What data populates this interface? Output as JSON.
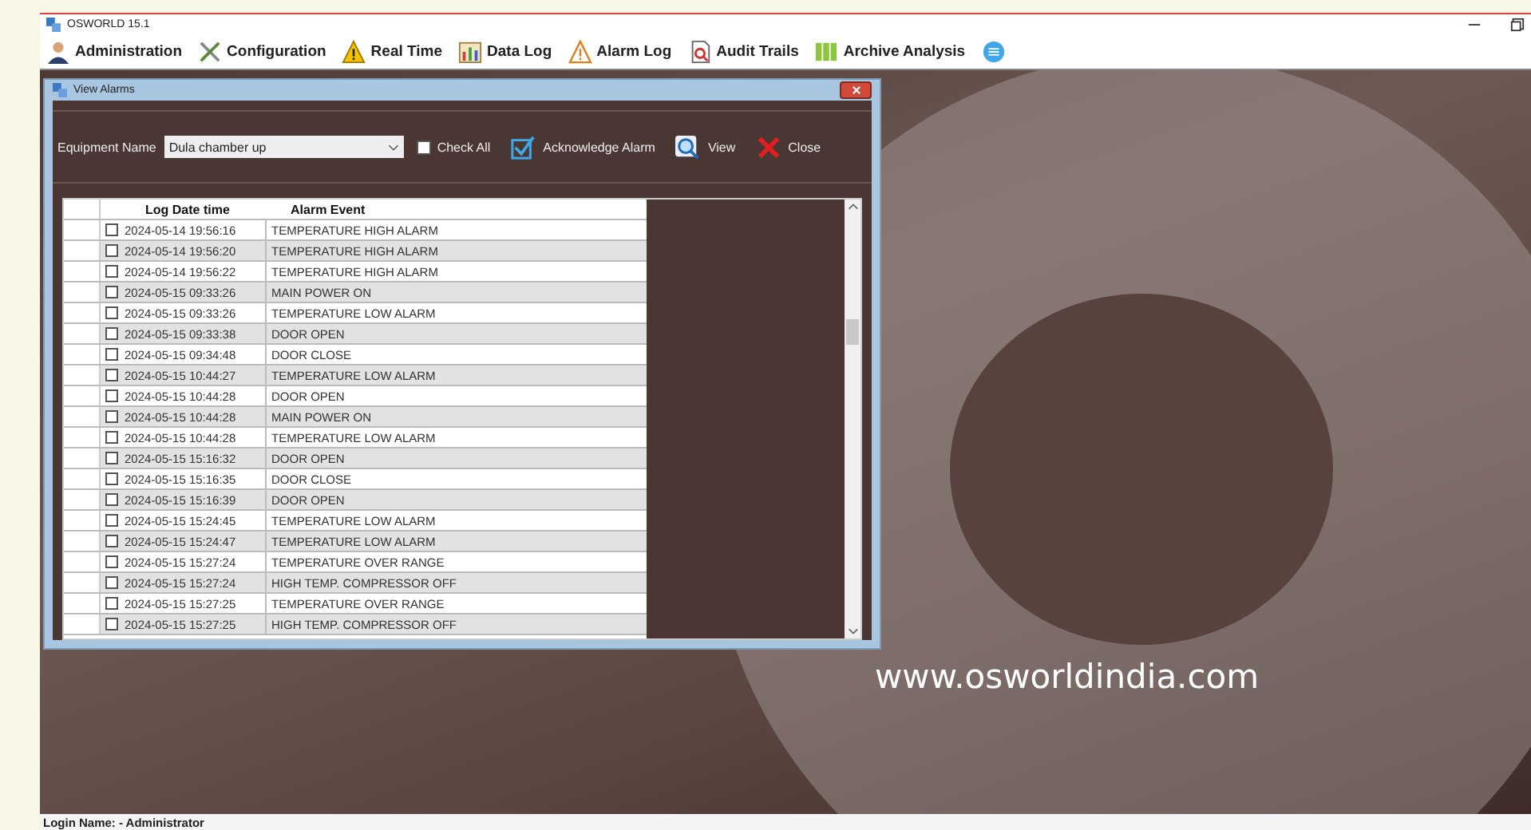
{
  "window": {
    "title": "OSWORLD 15.1"
  },
  "toolbar": [
    {
      "label": "Administration",
      "kind": "person"
    },
    {
      "label": "Configuration",
      "kind": "tools"
    },
    {
      "label": "Real Time",
      "kind": "warning"
    },
    {
      "label": "Data Log",
      "kind": "chart"
    },
    {
      "label": "Alarm Log",
      "kind": "alarm"
    },
    {
      "label": "Audit Trails",
      "kind": "audit"
    },
    {
      "label": "Archive Analysis",
      "kind": "archive"
    },
    {
      "kind": "menu"
    }
  ],
  "dialog": {
    "title": "View Alarms",
    "equipment_label": "Equipment Name",
    "equipment_value": "Dula chamber up",
    "check_all": {
      "label": "Check All",
      "checked": false
    },
    "buttons": [
      {
        "label": "Acknowledge Alarm",
        "kind": "acknowledge"
      },
      {
        "label": "View",
        "kind": "view"
      },
      {
        "label": "Close",
        "kind": "close"
      }
    ],
    "table": {
      "columns": [
        "Log Date time",
        "Alarm Event"
      ],
      "rows": [
        {
          "checked": false,
          "date": "2024-05-14 19:56:16",
          "event": "TEMPERATURE HIGH ALARM"
        },
        {
          "checked": false,
          "date": "2024-05-14 19:56:20",
          "event": "TEMPERATURE HIGH ALARM"
        },
        {
          "checked": false,
          "date": "2024-05-14 19:56:22",
          "event": "TEMPERATURE HIGH ALARM"
        },
        {
          "checked": false,
          "date": "2024-05-15 09:33:26",
          "event": "MAIN POWER ON"
        },
        {
          "checked": false,
          "date": "2024-05-15 09:33:26",
          "event": "TEMPERATURE LOW ALARM"
        },
        {
          "checked": false,
          "date": "2024-05-15 09:33:38",
          "event": "DOOR OPEN"
        },
        {
          "checked": false,
          "date": "2024-05-15 09:34:48",
          "event": "DOOR CLOSE"
        },
        {
          "checked": false,
          "date": "2024-05-15 10:44:27",
          "event": "TEMPERATURE LOW ALARM"
        },
        {
          "checked": false,
          "date": "2024-05-15 10:44:28",
          "event": "DOOR OPEN"
        },
        {
          "checked": false,
          "date": "2024-05-15 10:44:28",
          "event": "MAIN POWER ON"
        },
        {
          "checked": false,
          "date": "2024-05-15 10:44:28",
          "event": "TEMPERATURE LOW ALARM"
        },
        {
          "checked": false,
          "date": "2024-05-15 15:16:32",
          "event": "DOOR OPEN"
        },
        {
          "checked": false,
          "date": "2024-05-15 15:16:35",
          "event": "DOOR CLOSE"
        },
        {
          "checked": false,
          "date": "2024-05-15 15:16:39",
          "event": "DOOR OPEN"
        },
        {
          "checked": false,
          "date": "2024-05-15 15:24:45",
          "event": "TEMPERATURE LOW ALARM"
        },
        {
          "checked": false,
          "date": "2024-05-15 15:24:47",
          "event": "TEMPERATURE LOW ALARM"
        },
        {
          "checked": false,
          "date": "2024-05-15 15:27:24",
          "event": "TEMPERATURE OVER RANGE"
        },
        {
          "checked": false,
          "date": "2024-05-15 15:27:24",
          "event": "HIGH TEMP. COMPRESSOR OFF"
        },
        {
          "checked": false,
          "date": "2024-05-15 15:27:25",
          "event": "TEMPERATURE OVER RANGE"
        },
        {
          "checked": false,
          "date": "2024-05-15 15:27:25",
          "event": "HIGH TEMP. COMPRESSOR OFF"
        }
      ]
    }
  },
  "website": "www.osworldindia.com",
  "status_bar": "Login Name: - Administrator"
}
